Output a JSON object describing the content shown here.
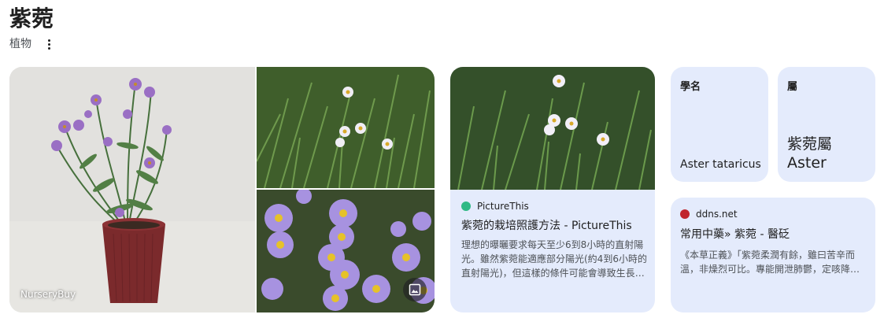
{
  "entity": {
    "title": "紫菀",
    "type": "植物"
  },
  "gallery": {
    "credit": "NurseryBuy"
  },
  "result1": {
    "source": "PictureThis",
    "title": "紫菀的栽培照護方法 - PictureThis",
    "snippet": "理想的曝曬要求每天至少6到8小時的直射陽光。雖然紫菀能適應部分陽光(約4到6小時的直射陽光)，但這樣的條件可能會導致生長不良。"
  },
  "facts": {
    "scientific_name": {
      "label": "學名",
      "value": "Aster tataricus"
    },
    "genus": {
      "label": "屬",
      "value_zh": "紫菀屬",
      "value_en": "Aster"
    }
  },
  "result2": {
    "source": "ddns.net",
    "title": "常用中藥» 紫菀 - 醫砭",
    "snippet": "《本草正義》「紫菀柔潤有餘，雖曰苦辛而溫，非燥烈可比。專能開泄肺鬱，定咳降逆。"
  },
  "icons": {
    "more": "more-vert-icon",
    "image": "image-icon",
    "favicon1": "picturethis-favicon",
    "favicon2": "ddns-favicon"
  },
  "colors": {
    "card_bg": "#e4ebfc",
    "favicon1": "#2fb985",
    "favicon2": "#c0262d"
  }
}
